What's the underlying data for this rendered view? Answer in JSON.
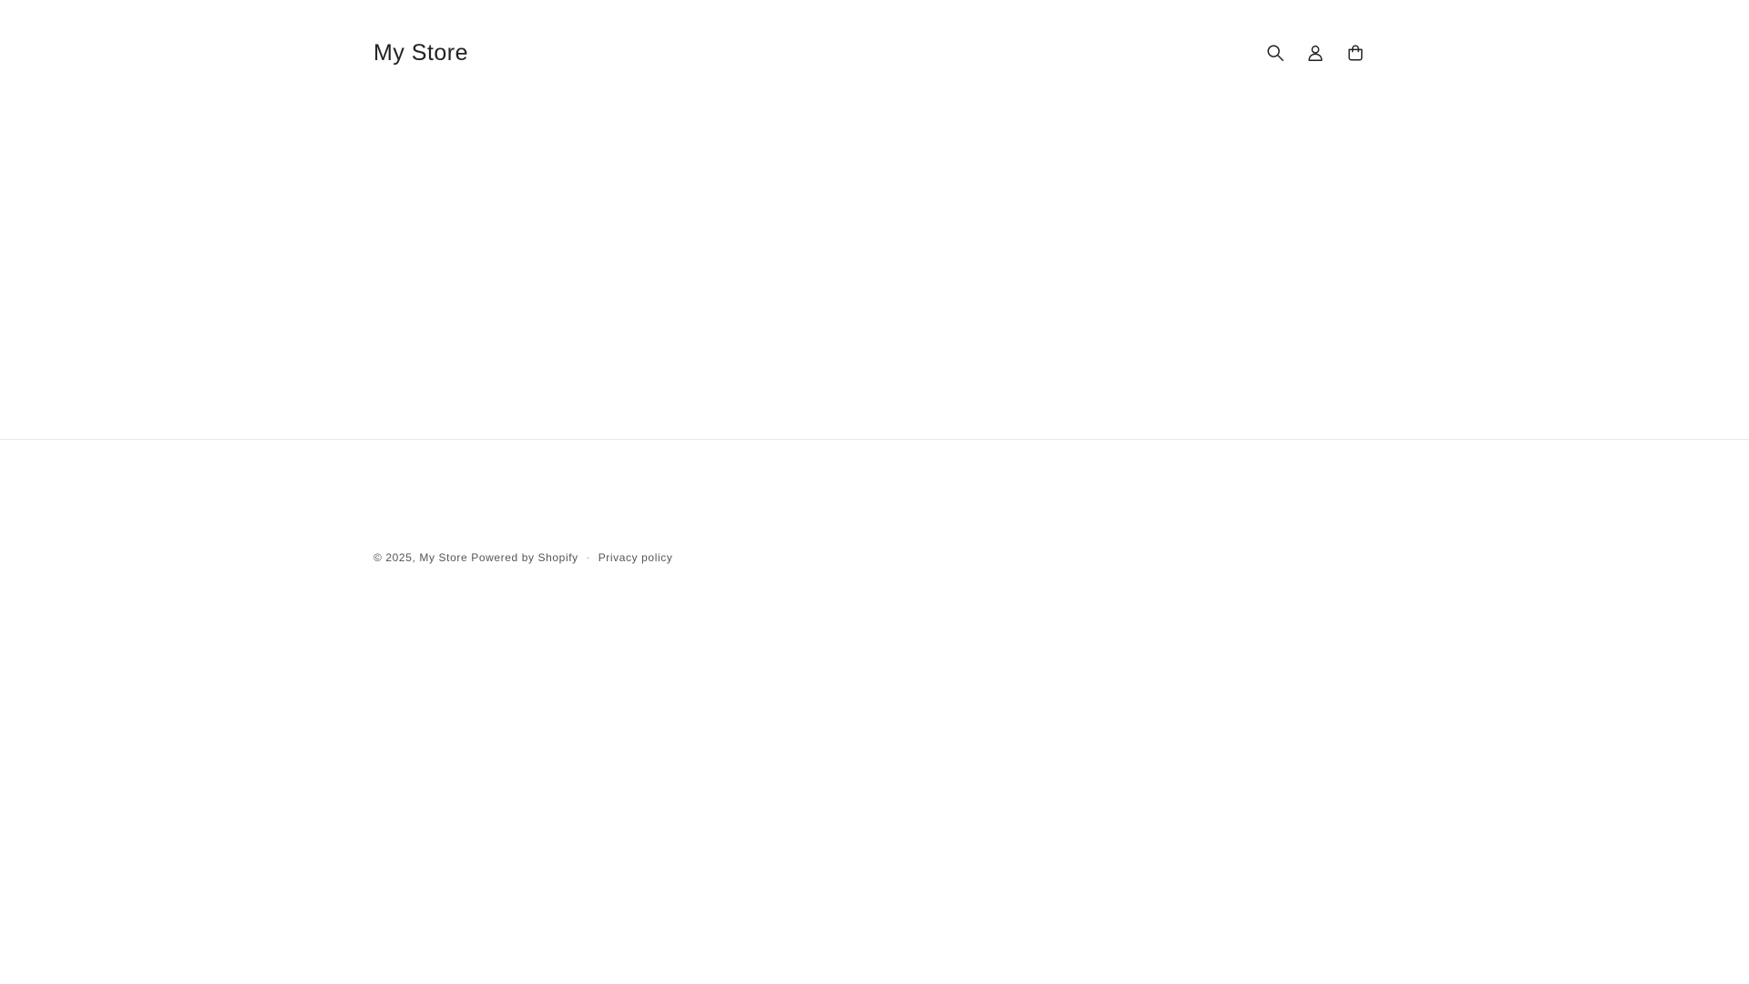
{
  "header": {
    "store_name": "My Store",
    "icons": [
      "search-icon",
      "account-icon",
      "cart-icon"
    ]
  },
  "footer": {
    "copyright_prefix": "© 2025,",
    "store_link": "My Store",
    "powered_by": "Powered by Shopify",
    "separator": "·",
    "privacy_link": "Privacy policy"
  },
  "colors": {
    "text": "#222222",
    "footer_text": "#555555",
    "divider": "#e8e8e8",
    "background": "#ffffff"
  }
}
